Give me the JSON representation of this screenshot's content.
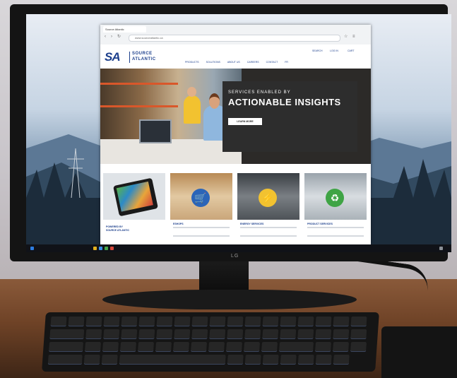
{
  "colors": {
    "brand_blue": "#1c3f8c",
    "hero_panel": "#2d2d2d",
    "badge_blue": "#2b65b8",
    "badge_yellow": "#f2c230",
    "badge_green": "#3fa445"
  },
  "monitor": {
    "brand": "LG"
  },
  "browser": {
    "tab_title": "Source Atlantic",
    "address": "www.sourceatlantic.ca"
  },
  "site": {
    "logo_mark": "SA",
    "logo_line1": "SOURCE",
    "logo_line2": "ATLANTIC",
    "utility_links": [
      "SEARCH",
      "LOG IN",
      "CART"
    ],
    "nav": [
      "PRODUCTS",
      "SOLUTIONS",
      "ABOUT US",
      "CAREERS",
      "CONTACT",
      "FR"
    ]
  },
  "hero": {
    "subtitle": "SERVICES ENABLED BY",
    "title": "ACTIONABLE INSIGHTS",
    "button": "LEARN MORE"
  },
  "cards": [
    {
      "title": "",
      "brand_line1": "POWERED BY",
      "brand_line2": "SOURCE ATLANTIC",
      "icon": "phone-image"
    },
    {
      "title": "ESHOPS",
      "icon": "cart-icon"
    },
    {
      "title": "ENERGY SERVICES",
      "icon": "lightning-icon"
    },
    {
      "title": "PRODUCT SERVICES",
      "icon": "recycle-icon"
    }
  ]
}
